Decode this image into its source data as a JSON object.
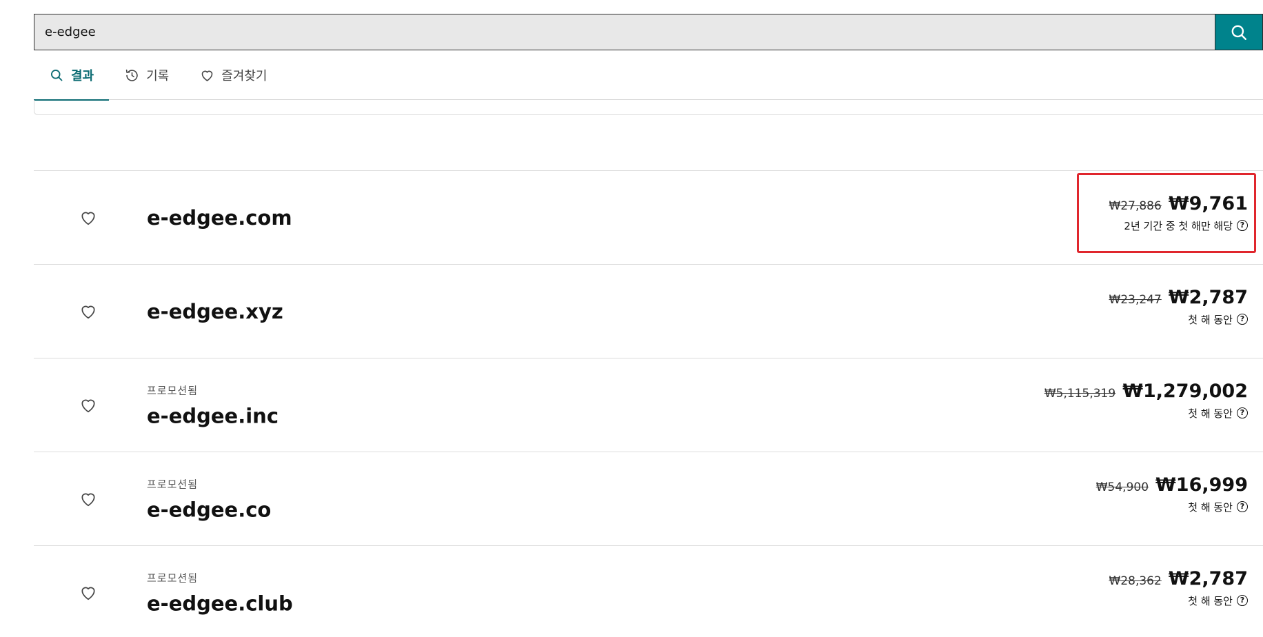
{
  "search": {
    "value": "e-edgee",
    "button_icon": "search-icon",
    "accent_color": "#00838c"
  },
  "tabs": [
    {
      "label": "결과",
      "icon": "search-icon",
      "active": true
    },
    {
      "label": "기록",
      "icon": "history-icon",
      "active": false
    },
    {
      "label": "즐겨찾기",
      "icon": "heart-icon",
      "active": false
    }
  ],
  "results": [
    {
      "promo": "",
      "domain": "e-edgee.com",
      "old_price": "₩27,886",
      "new_price": "₩9,761",
      "term": "2년 기간 중 첫 해만 해당",
      "highlighted": true
    },
    {
      "promo": "",
      "domain": "e-edgee.xyz",
      "old_price": "₩23,247",
      "new_price": "₩2,787",
      "term": "첫 해 동안",
      "highlighted": false
    },
    {
      "promo": "프로모션됨",
      "domain": "e-edgee.inc",
      "old_price": "₩5,115,319",
      "new_price": "₩1,279,002",
      "term": "첫 해 동안",
      "highlighted": false
    },
    {
      "promo": "프로모션됨",
      "domain": "e-edgee.co",
      "old_price": "₩54,900",
      "new_price": "₩16,999",
      "term": "첫 해 동안",
      "highlighted": false
    },
    {
      "promo": "프로모션됨",
      "domain": "e-edgee.club",
      "old_price": "₩28,362",
      "new_price": "₩2,787",
      "term": "첫 해 동안",
      "highlighted": false
    }
  ],
  "highlight_color": "#e0262d"
}
